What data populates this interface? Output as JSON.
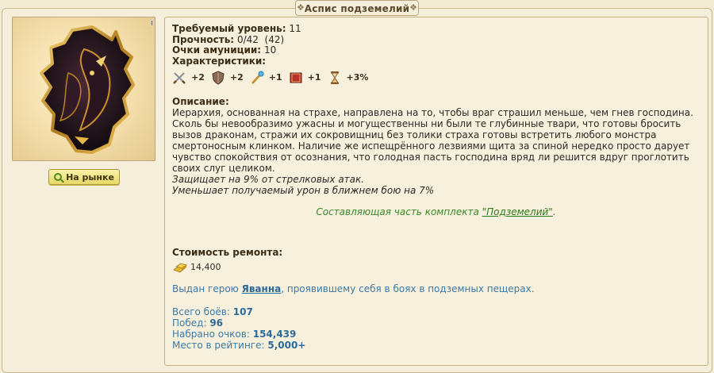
{
  "window": {
    "title": "Аспис подземелий"
  },
  "market_button": {
    "label": "На рынке"
  },
  "item": {
    "required_level_label": "Требуемый уровень:",
    "required_level_value": "11",
    "durability_label": "Прочность:",
    "durability_value": "0/42  (42)",
    "ammo_label": "Очки амуниции:",
    "ammo_value": "10",
    "characteristics_label": "Характеристики:",
    "stats": [
      {
        "icon": "crossed-swords-icon",
        "value": "+2"
      },
      {
        "icon": "shield-icon",
        "value": "+2"
      },
      {
        "icon": "magic-wand-icon",
        "value": "+1"
      },
      {
        "icon": "spellbook-icon",
        "value": "+1"
      },
      {
        "icon": "hourglass-icon",
        "value": "+3%"
      }
    ],
    "description_label": "Описание:",
    "description": "Иерархия, основанная на страхе, направлена на то, чтобы враг страшил меньше, чем гнев господина. Сколь бы невообразимо ужасны и могущественны ни были те глубинные твари, что готовы бросить вызов драконам, стражи их сокровищниц без толики страха готовы встретить любого монстра смертоносным клинком. Наличие же испещрённого лезвиями щита за спиной нередко просто дарует чувство спокойствия от осознания, что голодная пасть господина вряд ли решится вдруг проглотить своих слуг целиком.",
    "effect_1": "Защищает на 9% от стрелковых атак.",
    "effect_2": "Уменьшает получаемый урон в ближнем бою на 7%",
    "set_prefix": "Составляющая часть комплекта ",
    "set_name": "\"Подземелий\"",
    "set_suffix": ".",
    "repair_label": "Стоимость ремонта:",
    "repair_value": "14,400",
    "owner_prefix": "Выдан герою ",
    "owner_name": "Яванна",
    "owner_suffix": ", проявившему себя в боях в подземных пещерах.",
    "battles_label": "Всего боёв:",
    "battles_value": "107",
    "wins_label": "Побед:",
    "wins_value": "96",
    "points_label": "Набрано очков:",
    "points_value": "154,439",
    "rank_label": "Место в рейтинге:",
    "rank_value": "5,000+"
  },
  "colors": {
    "background": "#f3ecd4",
    "link_blue": "#2b6a9a",
    "set_green": "#3a8a2a",
    "button_yellow": "#e8d866"
  }
}
